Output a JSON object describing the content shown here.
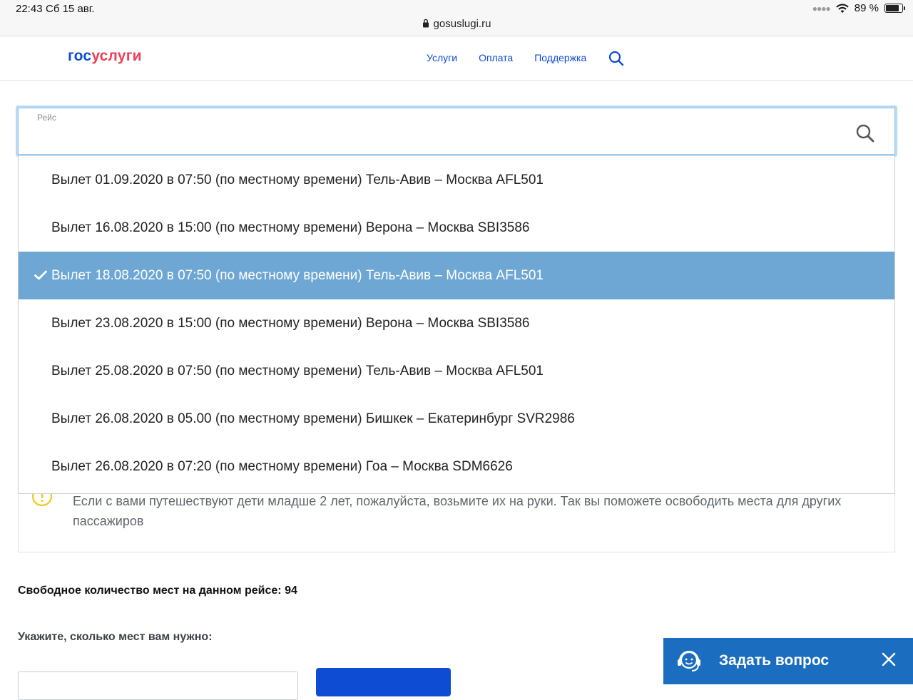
{
  "status_bar": {
    "time": "22:43",
    "date": "Сб 15 авг.",
    "url": "gosuslugi.ru",
    "battery": "89 %",
    "battery_level": 0.89
  },
  "header": {
    "logo_part1": "гос",
    "logo_part2": "услуги",
    "nav": [
      "Услуги",
      "Оплата",
      "Поддержка"
    ],
    "search_icon": "search-icon"
  },
  "flight_field": {
    "label": "Рейс",
    "icon": "search-icon"
  },
  "flights": [
    {
      "text": "Вылет 01.09.2020 в 07:50 (по местному времени) Тель-Авив – Москва AFL501",
      "selected": false
    },
    {
      "text": "Вылет 16.08.2020 в 15:00 (по местному времени) Верона – Москва SBI3586",
      "selected": false
    },
    {
      "text": "Вылет 18.08.2020 в 07:50 (по местному времени) Тель-Авив – Москва AFL501",
      "selected": true
    },
    {
      "text": "Вылет 23.08.2020 в 15:00 (по местному времени) Верона – Москва SBI3586",
      "selected": false
    },
    {
      "text": "Вылет 25.08.2020 в 07:50 (по местному времени) Тель-Авив – Москва AFL501",
      "selected": false
    },
    {
      "text": "Вылет 26.08.2020 в 05.00 (по местному времени) Бишкек – Екатеринбург SVR2986",
      "selected": false
    },
    {
      "text": "Вылет 26.08.2020 в 07:20 (по местному времени) Гоа – Москва SDM6626",
      "selected": false
    }
  ],
  "notice": {
    "text": "Если с вами путешествуют дети младше 2 лет, пожалуйста, возьмите их на руки. Так вы поможете освободить места для других пассажиров"
  },
  "seats_available": "Свободное количество мест на данном рейсе: 94",
  "seats_prompt": "Укажите, сколько мест вам нужно:",
  "chat": {
    "label": "Задать вопрос"
  },
  "colors": {
    "brand_blue": "#0d4cd3",
    "brand_red": "#ee3f58",
    "selected_row": "#6ea7d4",
    "chat_bg": "#1b6dbf",
    "warning": "#f5c518"
  }
}
